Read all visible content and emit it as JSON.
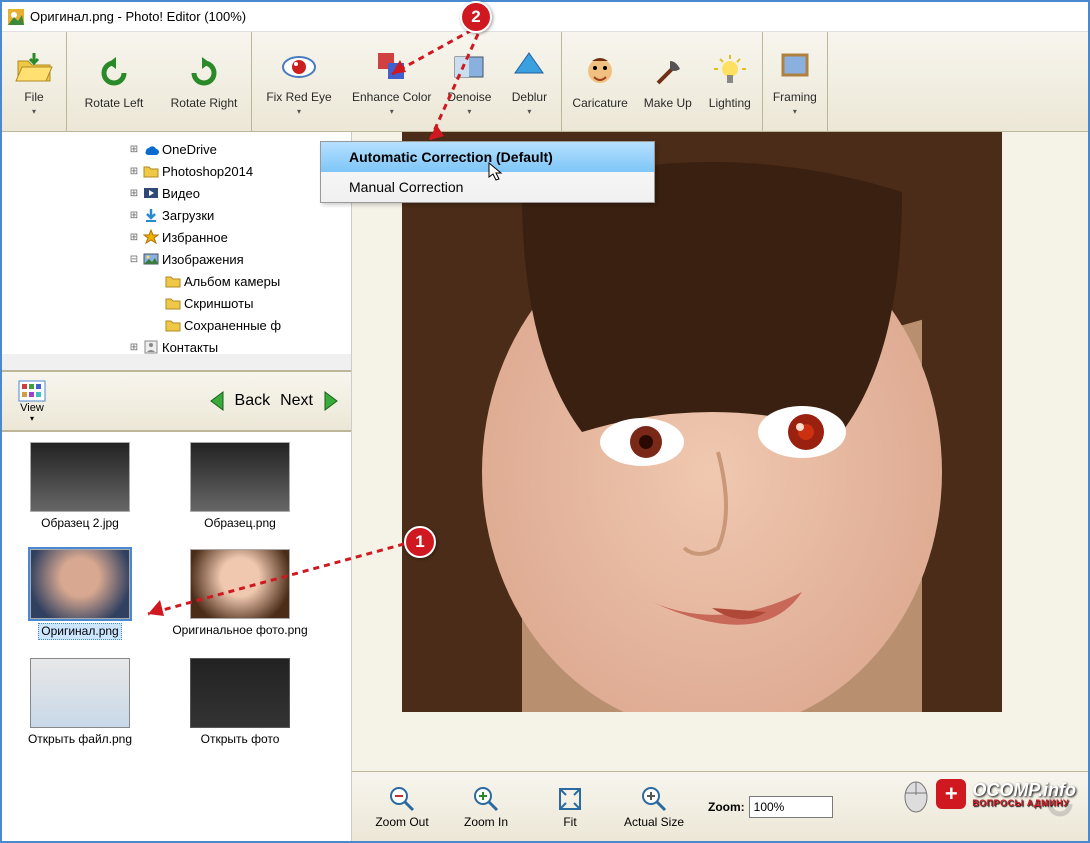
{
  "title": "Оригинал.png - Photo! Editor (100%)",
  "toolbar": {
    "file": "File",
    "rotate_left": "Rotate Left",
    "rotate_right": "Rotate Right",
    "fix_red_eye": "Fix Red Eye",
    "enhance_color": "Enhance Color",
    "denoise": "Denoise",
    "deblur": "Deblur",
    "caricature": "Caricature",
    "makeup": "Make Up",
    "lighting": "Lighting",
    "framing": "Framing"
  },
  "dropdown": {
    "auto": "Automatic Correction (Default)",
    "manual": "Manual Correction"
  },
  "tree": [
    {
      "indent": 1,
      "exp": "+",
      "icon": "onedrive",
      "label": "OneDrive"
    },
    {
      "indent": 1,
      "exp": "+",
      "icon": "folder",
      "label": "Photoshop2014"
    },
    {
      "indent": 1,
      "exp": "+",
      "icon": "video",
      "label": "Видео"
    },
    {
      "indent": 1,
      "exp": "+",
      "icon": "download",
      "label": "Загрузки"
    },
    {
      "indent": 1,
      "exp": "+",
      "icon": "star",
      "label": "Избранное"
    },
    {
      "indent": 1,
      "exp": "−",
      "icon": "pictures",
      "label": "Изображения"
    },
    {
      "indent": 2,
      "exp": "",
      "icon": "folder",
      "label": "Альбом камеры"
    },
    {
      "indent": 2,
      "exp": "",
      "icon": "folder",
      "label": "Скриншоты"
    },
    {
      "indent": 2,
      "exp": "",
      "icon": "folder",
      "label": "Сохраненные ф"
    },
    {
      "indent": 1,
      "exp": "+",
      "icon": "contacts",
      "label": "Контакты"
    }
  ],
  "nav": {
    "view": "View",
    "back": "Back",
    "next": "Next"
  },
  "thumbs": [
    {
      "cap": "Образец 2.jpg",
      "sel": false,
      "kind": "bw"
    },
    {
      "cap": "Образец.png",
      "sel": false,
      "kind": "bw"
    },
    {
      "cap": "Оригинал.png",
      "sel": true,
      "kind": "face-sel"
    },
    {
      "cap": "Оригинальное фото.png",
      "sel": false,
      "kind": "face"
    },
    {
      "cap": "Открыть файл.png",
      "sel": false,
      "kind": "screen"
    },
    {
      "cap": "Открыть фото",
      "sel": false,
      "kind": "screen-dark"
    }
  ],
  "zoom": {
    "out": "Zoom Out",
    "in": "Zoom In",
    "fit": "Fit",
    "actual": "Actual Size",
    "label": "Zoom:",
    "value": "100%"
  },
  "callouts": {
    "one": "1",
    "two": "2"
  },
  "watermark": {
    "brand": "OCOMP",
    "suffix": ".info",
    "tagline": "ВОПРОСЫ АДМИНУ"
  }
}
